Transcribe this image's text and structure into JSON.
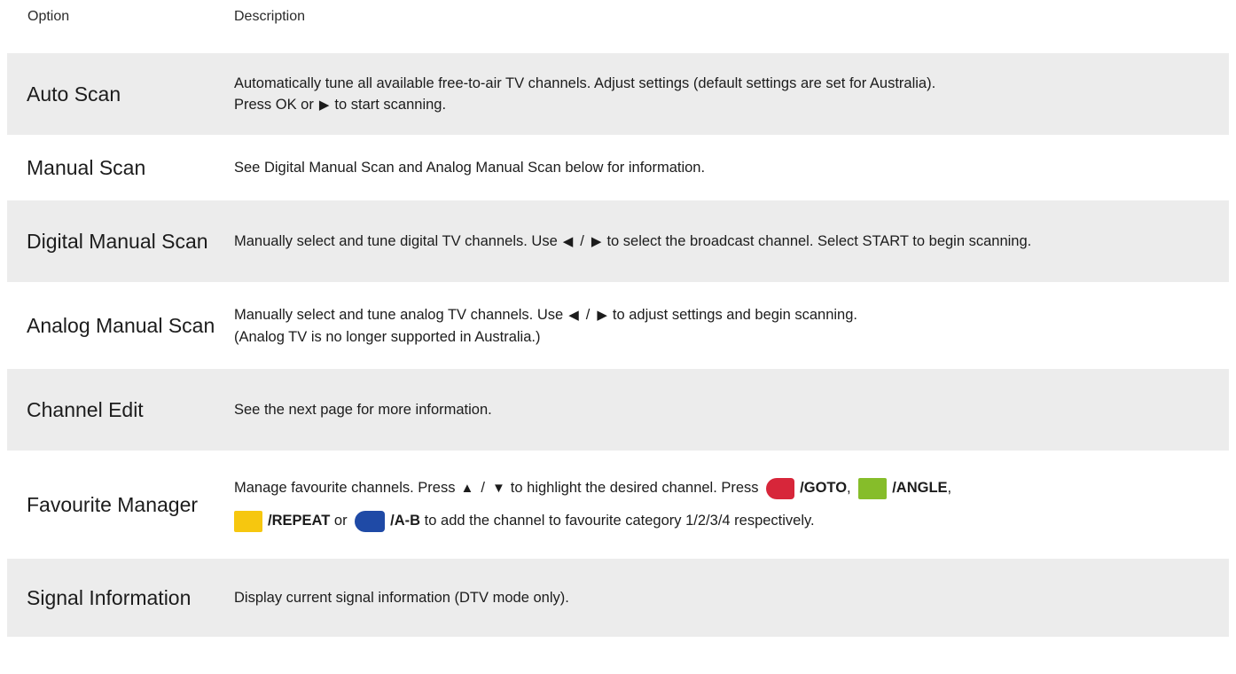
{
  "header": {
    "option": "Option",
    "description": "Description"
  },
  "rows": [
    {
      "option": "Auto Scan",
      "desc_a": "Automatically tune all available free-to-air TV channels. Adjust settings (default settings are set for Australia).",
      "desc_b_pre": "Press OK or",
      "desc_b_post": "to start scanning."
    },
    {
      "option": "Manual Scan",
      "desc": "See Digital Manual Scan and Analog Manual Scan below for information."
    },
    {
      "option": "Digital Manual Scan",
      "desc_pre": "Manually select and tune digital TV channels. Use",
      "desc_post": "to select the broadcast channel. Select START to begin scanning."
    },
    {
      "option": "Analog Manual Scan",
      "desc_pre": "Manually select and tune analog TV channels. Use",
      "desc_post": "to adjust settings and begin scanning.",
      "desc_note": "(Analog TV is no longer supported in Australia.)"
    },
    {
      "option": "Channel Edit",
      "desc": "See the next page for more information."
    },
    {
      "option": "Favourite Manager",
      "desc_pre": "Manage favourite channels. Press",
      "desc_mid": "to highlight the desired channel. Press",
      "keys": {
        "goto": "/GOTO",
        "angle": "/ANGLE",
        "repeat": "/REPEAT",
        "ab": "/A-B",
        "or": "or",
        "tail": "to add the channel to favourite category 1/2/3/4 respectively."
      },
      "colors": {
        "red": "#d7263a",
        "green": "#86bd2a",
        "yellow": "#f6c70f",
        "blue": "#1f4aa6"
      }
    },
    {
      "option": "Signal Information",
      "desc": "Display current signal information (DTV mode only)."
    }
  ],
  "icons": {
    "left": "◀",
    "right": "▶",
    "up": "▲",
    "down": "▼",
    "slash": "/"
  }
}
